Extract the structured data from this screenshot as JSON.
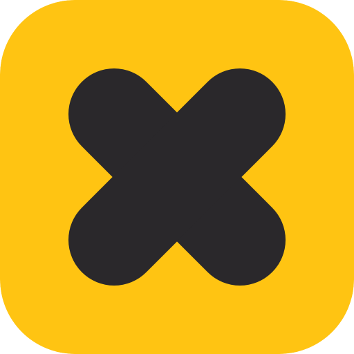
{
  "icon": {
    "name": "close-icon",
    "background_color": "#FFC412",
    "glyph_color": "#2A282B"
  }
}
